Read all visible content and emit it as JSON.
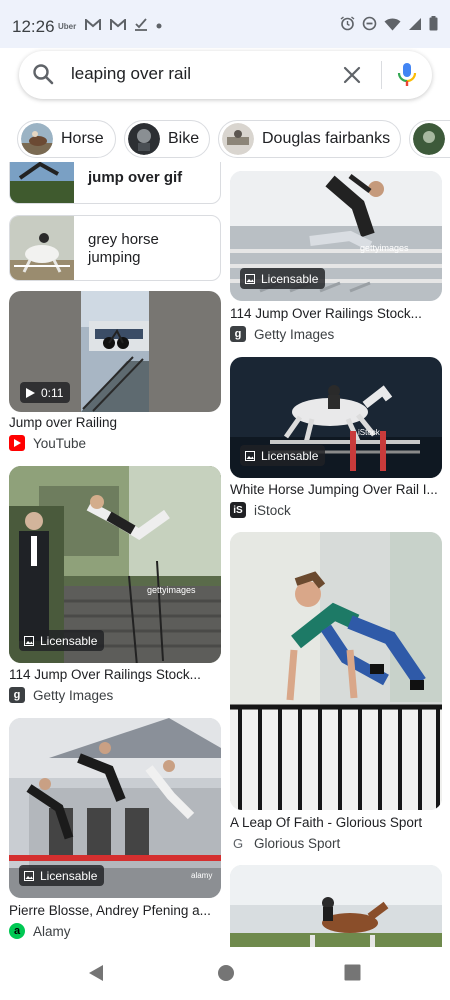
{
  "status": {
    "time": "12:26",
    "left_icons": [
      "uber-icon",
      "gmail-icon",
      "gmail-icon",
      "download-check-icon",
      "dot-icon"
    ],
    "uber_text": "Uber",
    "right_icons": [
      "alarm-icon",
      "dnd-icon",
      "wifi-icon",
      "signal-icon",
      "battery-icon"
    ]
  },
  "search": {
    "query": "leaping over rail"
  },
  "chips": [
    {
      "label": "Horse"
    },
    {
      "label": "Bike"
    },
    {
      "label": "Douglas fairbanks"
    }
  ],
  "results": {
    "left": {
      "top_text_card": {
        "label": "jump over gif"
      },
      "text_card": {
        "line1": "grey horse",
        "line2": "jumping"
      },
      "video": {
        "duration": "0:11",
        "caption": "Jump over Railing",
        "source": "YouTube"
      },
      "img1": {
        "badge": "Licensable",
        "caption": "114 Jump Over Railings Stock...",
        "source": "Getty Images"
      },
      "img2": {
        "badge": "Licensable",
        "caption": "Pierre Blosse, Andrey Pfening a...",
        "source": "Alamy"
      }
    },
    "right": {
      "img1": {
        "badge": "Licensable",
        "caption": "114 Jump Over Railings Stock...",
        "source": "Getty Images"
      },
      "img2": {
        "badge": "Licensable",
        "caption": "White Horse Jumping Over Rail I...",
        "source": "iStock"
      },
      "img3": {
        "caption": "A Leap Of Faith - Glorious Sport",
        "source": "Glorious Sport"
      }
    }
  },
  "colors": {
    "youtube": "#ff0000",
    "getty": "#3c4043",
    "istock": "#202124",
    "alamy": "#00c853",
    "mic_blue": "#4285f4",
    "mic_red": "#ea4335",
    "mic_yellow": "#fbbc05",
    "mic_green": "#34a853"
  }
}
